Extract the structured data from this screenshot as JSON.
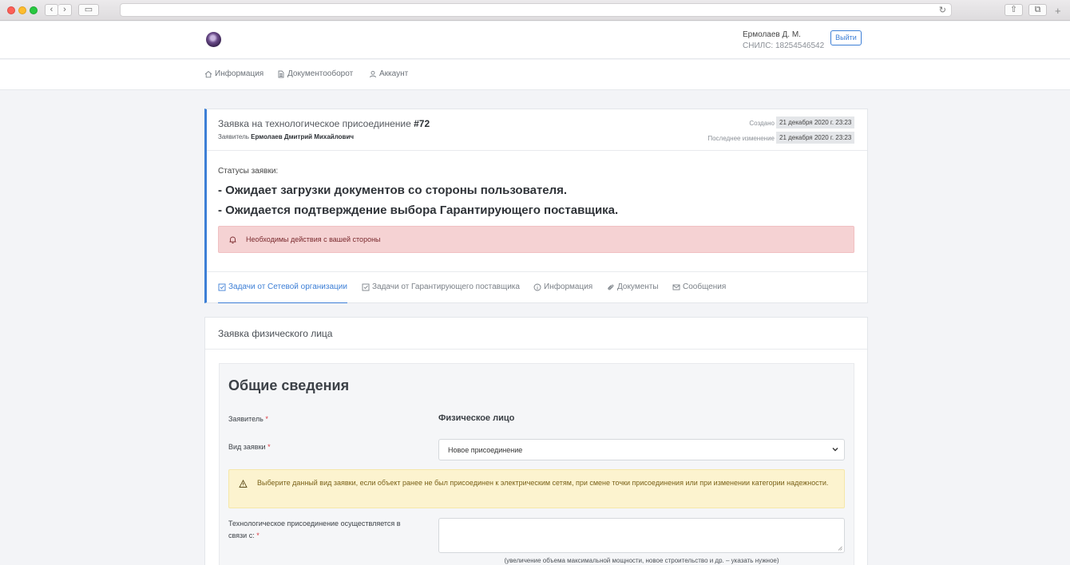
{
  "browser": {
    "icons": [
      "back-icon",
      "forward-icon",
      "sidebar-icon",
      "reload-icon",
      "share-icon",
      "tabs-icon",
      "new-tab-icon"
    ]
  },
  "header": {
    "user_name": "Ермолаев Д. М.",
    "snils": "СНИЛС: 18254546542",
    "logout_label": "Выйти"
  },
  "nav": {
    "items": [
      {
        "label": "Информация",
        "icon": "home-icon"
      },
      {
        "label": "Документооборот",
        "icon": "document-icon"
      },
      {
        "label": "Аккаунт",
        "icon": "user-icon"
      }
    ]
  },
  "request": {
    "title": "Заявка на технологическое присоединение ",
    "number": "#72",
    "applicant_prefix": "Заявитель ",
    "applicant_name": "Ермолаев Дмитрий Михайлович",
    "created_label": "Создано",
    "created_value": "21 декабря 2020 г. 23:23",
    "modified_label": "Последнее изменение",
    "modified_value": "21 декабря 2020 г. 23:23",
    "statuses_caption": "Статусы заявки:",
    "statuses": [
      "- Ожидает загрузки документов со стороны пользователя.",
      "- Ожидается подтверждение выбора Гарантирующего поставщика."
    ],
    "action_alert": "Необходимы действия с вашей стороны",
    "tabs": [
      {
        "label": "Задачи от Сетевой организации",
        "icon": "checkbox-icon",
        "active": true
      },
      {
        "label": "Задачи от Гарантирующего поставщика",
        "icon": "checkbox-icon",
        "active": false
      },
      {
        "label": "Информация",
        "icon": "info-icon",
        "active": false
      },
      {
        "label": "Документы",
        "icon": "paperclip-icon",
        "active": false
      },
      {
        "label": "Сообщения",
        "icon": "envelope-icon",
        "active": false
      }
    ]
  },
  "form": {
    "card_title": "Заявка физического лица",
    "section_title": "Общие сведения",
    "applicant_label": "Заявитель",
    "applicant_value": "Физическое лицо",
    "request_type_label": "Вид заявки",
    "request_type_value": "Новое присоединение",
    "request_type_hint": "Выберите данный вид заявки, если объект ранее не был присоединен к электрическим сетям, при смене точки присоединения или при изменении категории надежности.",
    "reason_label": "Технологическое присоединение осуществляется в связи с:",
    "reason_value": "",
    "reason_hint": "(увеличение объема максимальной мощности, новое строительство и др. – указать нужное)",
    "required_mark": "*"
  },
  "colors": {
    "accent": "#3d7fd6",
    "danger_bg": "#f5d2d3",
    "warning_bg": "#fcf3cf",
    "required": "#d9363e"
  }
}
